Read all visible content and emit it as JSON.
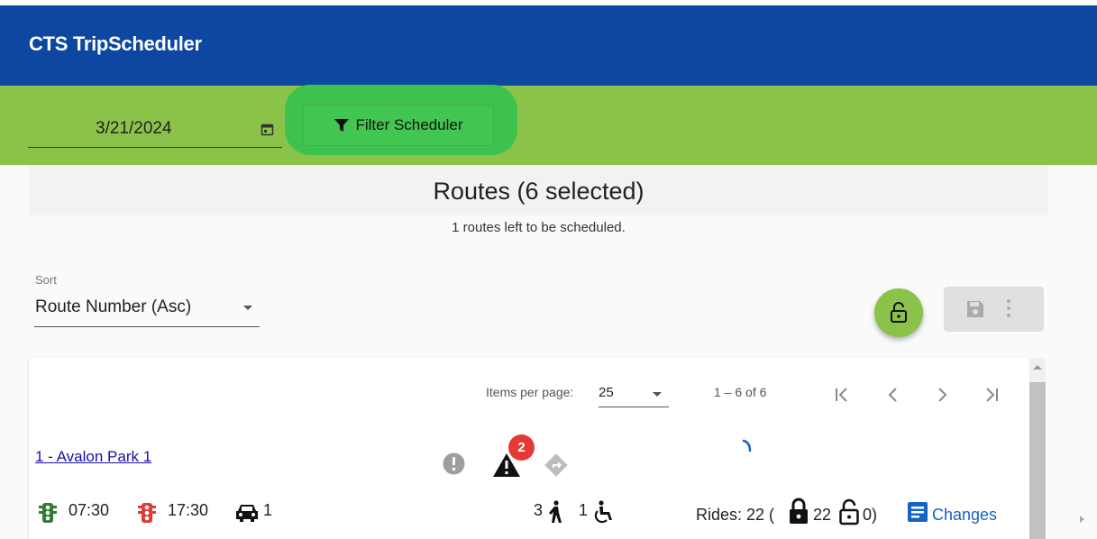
{
  "app": {
    "title": "CTS TripScheduler"
  },
  "filter": {
    "date": "3/21/2024",
    "filter_button_label": "Filter Scheduler"
  },
  "routes": {
    "title": "Routes (6 selected)",
    "subtitle": "1 routes left to be scheduled."
  },
  "sort": {
    "label": "Sort",
    "value": "Route Number (Asc)"
  },
  "pagination": {
    "items_per_page_label": "Items per page:",
    "items_per_page_value": "25",
    "range": "1 – 6 of 6"
  },
  "route_item": {
    "link": "1 - Avalon Park 1",
    "warning_count": "2",
    "start_time": "07:30",
    "end_time": "17:30",
    "vehicles": "1",
    "ambulatory_count": "3",
    "wheelchair_count": "1",
    "rides_prefix": "Rides: 22 (",
    "locked_count": "22",
    "unlocked_count": "0)",
    "changes_label": "Changes"
  },
  "colors": {
    "header_blue": "#0d47a1",
    "filter_green": "#8bc34a",
    "highlight_green": "#3ec24f",
    "link_blue": "#1a0dab",
    "badge_red": "#e53935",
    "start_light_green": "#2e7d32",
    "end_light_red": "#e53935"
  }
}
